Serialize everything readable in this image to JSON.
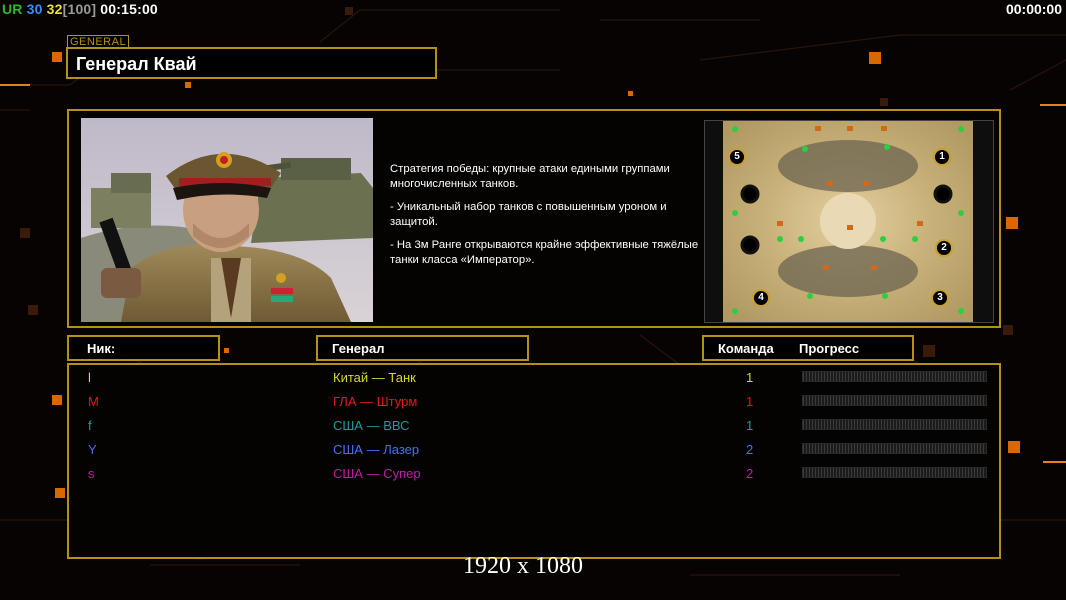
{
  "hud": {
    "tag_ur": "UR",
    "val_30": "30",
    "val_32": "32",
    "val_100": "[100]",
    "timer_left": "00:15:00",
    "timer_right": "00:00:00"
  },
  "general_tag": "GENERAL",
  "general_name": "Генерал Квай",
  "description": {
    "line1": "Стратегия победы: крупные атаки едиными группами многочисленных танков.",
    "line2": "- Уникальный набор танков с повышенным уроном и защитой.",
    "line3": "- На 3м Ранге открываются крайне эффективные тяжёлые танки класса «Император»."
  },
  "minimap": {
    "start_positions": [
      "5",
      "1",
      "2",
      "4",
      "3"
    ]
  },
  "headers": {
    "nick": "Ник:",
    "general": "Генерал",
    "team": "Команда",
    "progress": "Прогресс"
  },
  "players": [
    {
      "nick": "l",
      "general": "Китай — Танк",
      "team": "1",
      "color": "#d8d830"
    },
    {
      "nick": "M",
      "general": "ГЛА — Штурм",
      "team": "1",
      "color": "#e01b1b"
    },
    {
      "nick": "f",
      "general": "США — ВВС",
      "team": "1",
      "color": "#1f9a9a"
    },
    {
      "nick": "Y",
      "general": "США — Лазер",
      "team": "2",
      "color": "#4b6cff"
    },
    {
      "nick": "s",
      "general": "США — Супер",
      "team": "2",
      "color": "#c01ca8"
    }
  ],
  "resolution": "1920 x 1080",
  "colors": {
    "gold_border": "#b59113",
    "ur": "#2db82d",
    "val_30": "#3a8cff",
    "val_32": "#e8e13a",
    "val_100": "#9a9a9a"
  }
}
